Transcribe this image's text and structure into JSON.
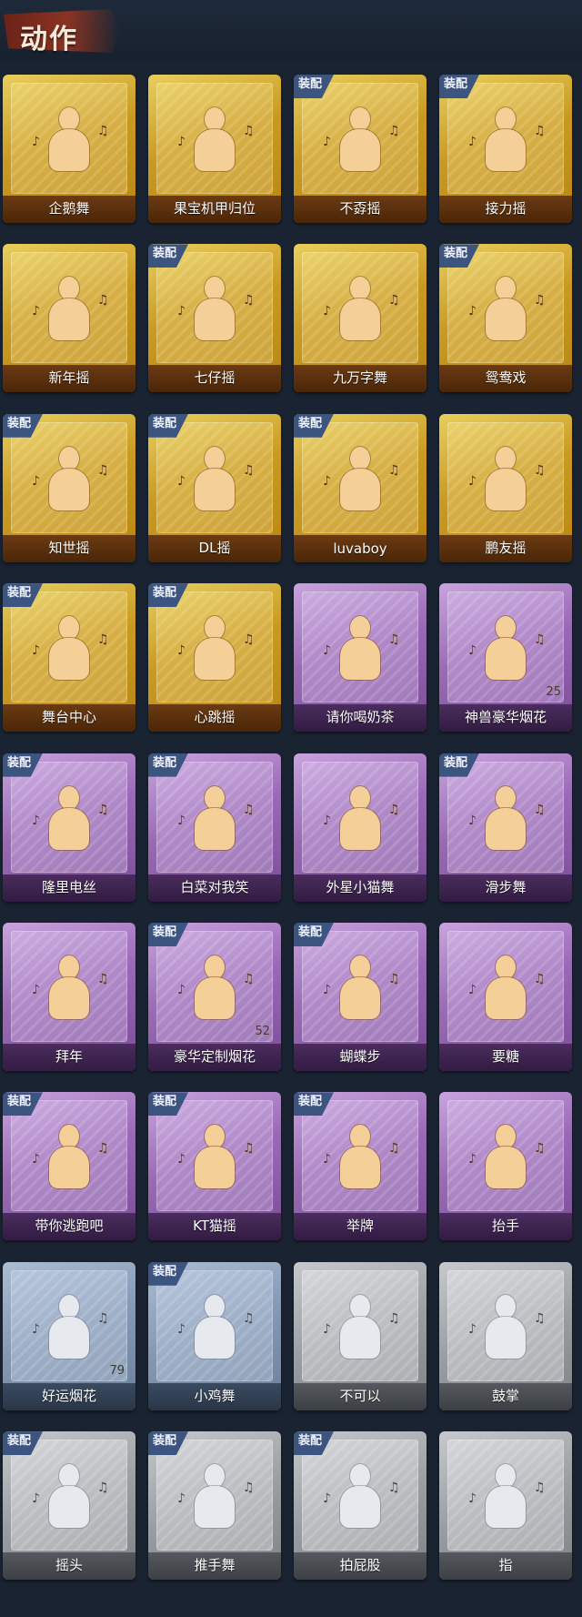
{
  "header": {
    "title": "动作"
  },
  "badge_text": "装配",
  "items": [
    {
      "label": "企鹅舞",
      "rarity": "gold",
      "equipped": false
    },
    {
      "label": "果宝机甲归位",
      "rarity": "gold",
      "equipped": false
    },
    {
      "label": "不孬摇",
      "rarity": "gold",
      "equipped": true
    },
    {
      "label": "接力摇",
      "rarity": "gold",
      "equipped": true
    },
    {
      "label": "新年摇",
      "rarity": "gold",
      "equipped": false
    },
    {
      "label": "七仔摇",
      "rarity": "gold",
      "equipped": true
    },
    {
      "label": "九万字舞",
      "rarity": "gold",
      "equipped": false
    },
    {
      "label": "鸳鸯戏",
      "rarity": "gold",
      "equipped": true
    },
    {
      "label": "知世摇",
      "rarity": "gold",
      "equipped": true
    },
    {
      "label": "DL摇",
      "rarity": "gold",
      "equipped": true
    },
    {
      "label": "luvaboy",
      "rarity": "gold",
      "equipped": true
    },
    {
      "label": "鹏友摇",
      "rarity": "gold",
      "equipped": false
    },
    {
      "label": "舞台中心",
      "rarity": "gold",
      "equipped": true
    },
    {
      "label": "心跳摇",
      "rarity": "gold",
      "equipped": true
    },
    {
      "label": "请你喝奶茶",
      "rarity": "purple",
      "equipped": false
    },
    {
      "label": "神兽豪华烟花",
      "rarity": "purple",
      "equipped": false,
      "count": "25"
    },
    {
      "label": "隆里电丝",
      "rarity": "purple",
      "equipped": true
    },
    {
      "label": "白菜对我笑",
      "rarity": "purple",
      "equipped": true
    },
    {
      "label": "外星小猫舞",
      "rarity": "purple",
      "equipped": false
    },
    {
      "label": "滑步舞",
      "rarity": "purple",
      "equipped": true
    },
    {
      "label": "拜年",
      "rarity": "purple",
      "equipped": false
    },
    {
      "label": "豪华定制烟花",
      "rarity": "purple",
      "equipped": true,
      "count": "52"
    },
    {
      "label": "蝴蝶步",
      "rarity": "purple",
      "equipped": true
    },
    {
      "label": "要糖",
      "rarity": "purple",
      "equipped": false
    },
    {
      "label": "带你逃跑吧",
      "rarity": "purple",
      "equipped": true
    },
    {
      "label": "KT猫摇",
      "rarity": "purple",
      "equipped": true
    },
    {
      "label": "举牌",
      "rarity": "purple",
      "equipped": true
    },
    {
      "label": "抬手",
      "rarity": "purple",
      "equipped": false
    },
    {
      "label": "好运烟花",
      "rarity": "blue",
      "equipped": false,
      "count": "79"
    },
    {
      "label": "小鸡舞",
      "rarity": "blue",
      "equipped": true
    },
    {
      "label": "不可以",
      "rarity": "gray",
      "equipped": false
    },
    {
      "label": "鼓掌",
      "rarity": "gray",
      "equipped": false
    },
    {
      "label": "摇头",
      "rarity": "gray",
      "equipped": true
    },
    {
      "label": "推手舞",
      "rarity": "gray",
      "equipped": true
    },
    {
      "label": "拍屁股",
      "rarity": "gray",
      "equipped": true
    },
    {
      "label": "指",
      "rarity": "gray",
      "equipped": false
    }
  ]
}
